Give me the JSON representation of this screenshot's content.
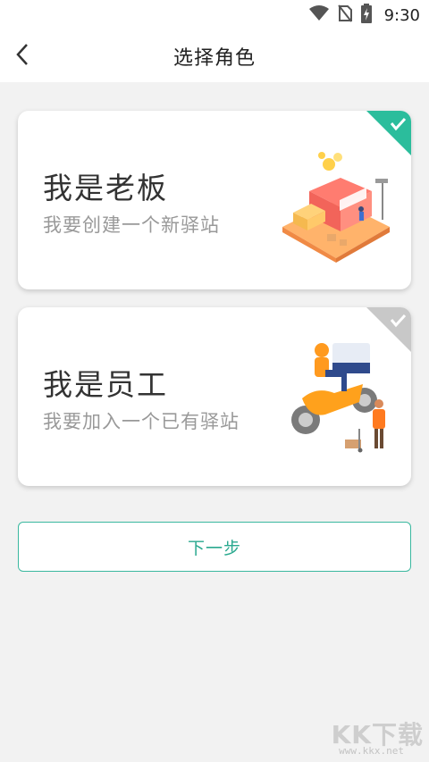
{
  "status_bar": {
    "time": "9:30",
    "icons": [
      "wifi-icon",
      "no-sim-icon",
      "battery-charging-icon"
    ]
  },
  "appbar": {
    "title": "选择角色",
    "back_icon": "chevron-left-icon"
  },
  "roles": [
    {
      "title": "我是老板",
      "subtitle": "我要创建一个新驿站",
      "selected": true,
      "illustration": "shop-building-illustration"
    },
    {
      "title": "我是员工",
      "subtitle": "我要加入一个已有驿站",
      "selected": false,
      "illustration": "delivery-courier-illustration"
    }
  ],
  "next_button": {
    "label": "下一步"
  },
  "watermark": {
    "text": "KK下载",
    "url": "www.kkx.net"
  },
  "colors": {
    "accent": "#2aa98f",
    "selected_corner": "#2bbd9c",
    "unselected_corner": "#c8c8c8",
    "background": "#f2f2f2"
  }
}
